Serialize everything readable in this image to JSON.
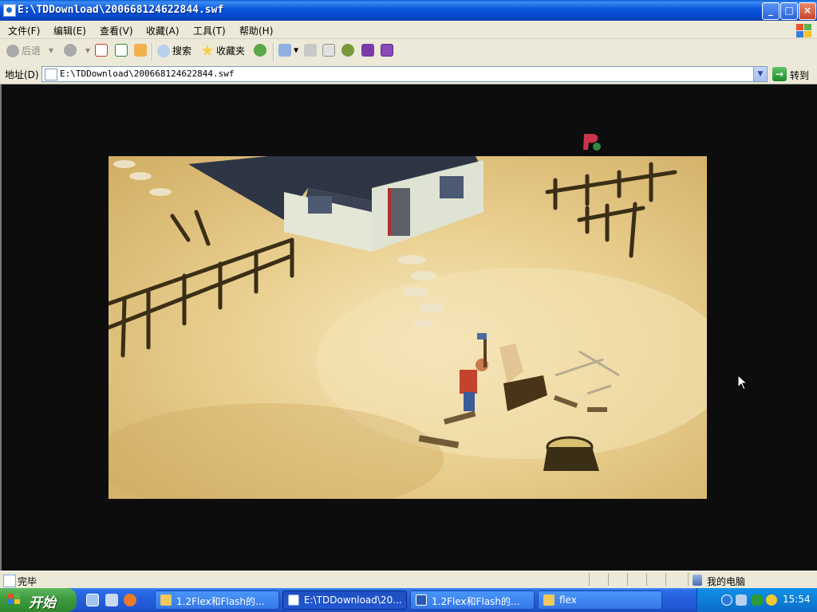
{
  "window": {
    "title": "E:\\TDDownload\\200668124622844.swf",
    "controls": {
      "minimize": "_",
      "maximize": "□",
      "close": "×"
    }
  },
  "menu": [
    "文件(F)",
    "编辑(E)",
    "查看(V)",
    "收藏(A)",
    "工具(T)",
    "帮助(H)"
  ],
  "toolbar": {
    "back_label": "后退",
    "search_label": "搜索",
    "favorites_label": "收藏夹"
  },
  "address": {
    "label": "地址(D)",
    "value": "E:\\TDDownload\\200668124622844.swf",
    "go_label": "转到"
  },
  "status": {
    "text": "完毕",
    "zone": "我的电脑"
  },
  "taskbar": {
    "start_label": "开始",
    "tasks": [
      {
        "label": "1.2Flex和Flash的...",
        "icon": "folder-icon",
        "active": false
      },
      {
        "label": "E:\\TDDownload\\20...",
        "icon": "ie-icon",
        "active": true
      },
      {
        "label": "1.2Flex和Flash的...",
        "icon": "word-icon",
        "active": false
      },
      {
        "label": "flex",
        "icon": "folder-icon",
        "active": false
      }
    ],
    "clock": "15:54"
  },
  "colors": {
    "titlebar": "#0a5fd8",
    "taskbar": "#245edb",
    "start_button": "#3d9a3d",
    "content_background": "#0d0d0d"
  }
}
